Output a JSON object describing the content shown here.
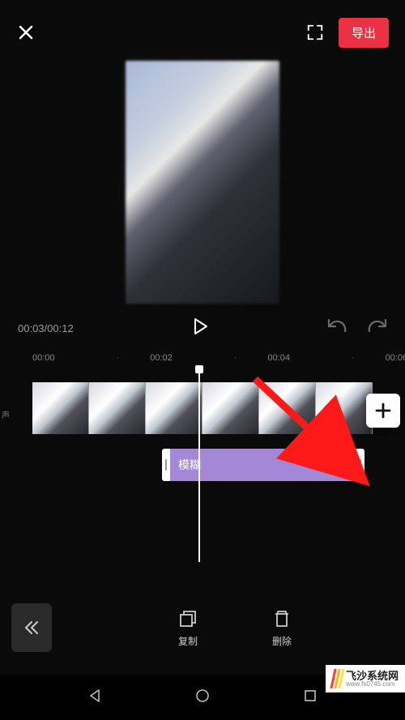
{
  "header": {
    "export_label": "导出"
  },
  "playback": {
    "current_time": "00:03",
    "total_time": "00:12"
  },
  "ruler": {
    "marks": [
      "00:00",
      "00:02",
      "00:04",
      "00:06"
    ]
  },
  "timeline": {
    "track_label": "声",
    "effect_label": "模糊"
  },
  "toolbar": {
    "copy_label": "复制",
    "delete_label": "删除"
  },
  "watermark": {
    "title": "飞沙系统网",
    "url": "www.fs0745.com"
  },
  "colors": {
    "accent": "#ed3144",
    "effect": "#a388d8",
    "arrow": "#ff1a1a"
  }
}
